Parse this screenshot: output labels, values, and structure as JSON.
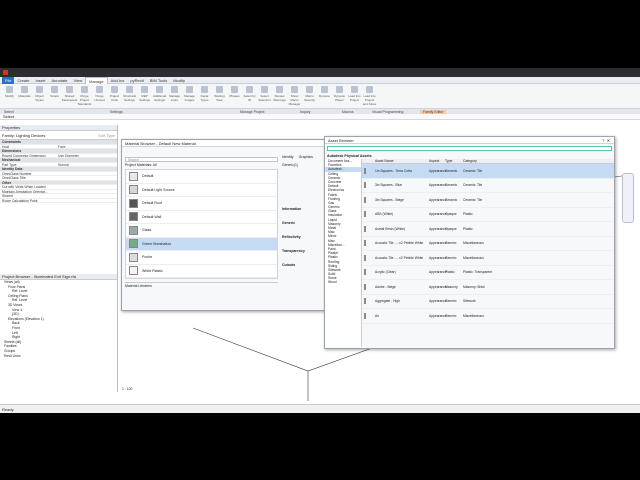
{
  "window": {
    "menu": [
      "File",
      "Create",
      "Insert",
      "Annotate",
      "View",
      "Manage",
      "Add-Ins",
      "pyRevit",
      "BIM Tools",
      "Modify"
    ],
    "active_tab": "Manage"
  },
  "ribbon": {
    "buttons": [
      "Modify",
      "Materials",
      "Object Styles",
      "Snaps",
      "Shared Parameters",
      "Purge Project Standards",
      "Purge Unused",
      "Project Units",
      "Structural Settings",
      "MEP Settings",
      "Additional Settings",
      "Manage Links",
      "Manage Images",
      "Decal Types",
      "Starting View",
      "Phases",
      "Select by ID",
      "Select Selection",
      "Review Warnings",
      "Show Macro Manager",
      "Macro Security",
      "Dynamo",
      "Dynamo Player",
      "Load into Project",
      "Load into Project and Close"
    ],
    "panels": [
      "Select",
      "Settings",
      "Manage Project",
      "Inquiry",
      "Macros",
      "Visual Programming",
      "Family Editor"
    ]
  },
  "quick": "Select",
  "properties": {
    "title": "Properties",
    "type": "Family: Lighting Devices",
    "edit_type": "Edit Type",
    "rows": [
      {
        "k": "Constraints",
        "v": "",
        "sec": true
      },
      {
        "k": "Host",
        "v": "Face"
      },
      {
        "k": "Dimensions",
        "v": "",
        "sec": true
      },
      {
        "k": "Round Connector Dimension",
        "v": "Use Diameter"
      },
      {
        "k": "Mechanical",
        "v": "",
        "sec": true
      },
      {
        "k": "Part Type",
        "v": "Normal"
      },
      {
        "k": "Identity Data",
        "v": "",
        "sec": true
      },
      {
        "k": "OmniClass Number",
        "v": ""
      },
      {
        "k": "OmniClass Title",
        "v": ""
      },
      {
        "k": "Other",
        "v": "",
        "sec": true
      },
      {
        "k": "Cut with Voids When Loaded",
        "v": ""
      },
      {
        "k": "Maintain Annotation Orientat...",
        "v": ""
      },
      {
        "k": "Shared",
        "v": ""
      },
      {
        "k": "Room Calculation Point",
        "v": ""
      }
    ],
    "help": "Properties help",
    "apply": "Apply"
  },
  "browser": {
    "title": "Project Browser - Illuminated Exit Sign.rfa",
    "items": [
      "Views (all)",
      "Floor Plans",
      "Ref. Level",
      "Ceiling Plans",
      "Ref. Level",
      "3D Views",
      "View 1",
      "{3D}",
      "Elevations (Elevation 1)",
      "Back",
      "Front",
      "Left",
      "Right",
      "Sheets (all)",
      "Families",
      "Groups",
      "Revit Links"
    ]
  },
  "status": {
    "left": "Ready",
    "scale": "1 : 100"
  },
  "material_browser": {
    "title": "Material Browser - Default New Material",
    "search_placeholder": "Search",
    "list_title": "Project Materials: All",
    "materials": [
      "Default",
      "Default Light Source",
      "Default Roof",
      "Default Wall",
      "Glass",
      "Green Illumination",
      "Poche",
      "White Plastic"
    ],
    "libraries": "Material Libraries",
    "tabs": [
      "Identity",
      "Graphics"
    ],
    "asset": "Generic(1)",
    "sections": [
      "Information",
      "Generic",
      "Reflectivity",
      "Transparency",
      "Cutouts"
    ],
    "props": [
      "Color",
      "Image",
      "Image Fade",
      "Glossiness",
      "Highlights"
    ]
  },
  "asset_browser": {
    "title": "Asset Browser",
    "search_placeholder": "",
    "heading": "Autodesk Physical Assets",
    "cols": [
      "Asset Name",
      "Aspect",
      "Type",
      "Category"
    ],
    "tree": [
      "Document Ass...",
      "Favorites",
      "Autodesk...",
      "Ceiling",
      "Ceramic",
      "Concrete",
      "Default",
      "Electronics",
      "Fabric",
      "Flooring",
      "Gas",
      "Generic",
      "Glass",
      "Insulation",
      "Liquid",
      "Masonry",
      "Metal",
      "Misc",
      "Mirror",
      "Misc",
      "Miscellan...",
      "Paint",
      "Plaster",
      "Plastic",
      "Roofing",
      "Siding",
      "Sitework",
      "Solid",
      "Stone",
      "Wood"
    ],
    "rows": [
      [
        "1in Squares - Terra Cotta",
        "Appearance",
        "Ceramic",
        "Ceramic: Tile"
      ],
      [
        "3in Squares - Blue",
        "Appearance",
        "Ceramic",
        "Ceramic: Tile"
      ],
      [
        "3in Squares - Beige",
        "Appearance",
        "Ceramic",
        "Ceramic: Tile"
      ],
      [
        "ABS (White)",
        "Appearance",
        "Opaque",
        "Plastic"
      ],
      [
        "Acetal Resin (White)",
        "Appearance",
        "Opaque",
        "Plastic"
      ],
      [
        "Acoustic Tile - ...x2 Pebble White",
        "Appearance",
        "Generic",
        "Miscellaneous"
      ],
      [
        "Acoustic Tile - ...x2 Pebble White",
        "Appearance",
        "Generic",
        "Miscellaneous"
      ],
      [
        "Acrylic (Clear)",
        "Appearance",
        "Plastic",
        "Plastic: Transparent"
      ],
      [
        "Adobe - Beige",
        "Appearance",
        "Masonry",
        "Masonry: Brick"
      ],
      [
        "Aggregate - High",
        "Appearance",
        "Generic",
        "Sitework"
      ],
      [
        "Air",
        "Appearance",
        "Generic",
        "Miscellaneous"
      ]
    ]
  }
}
